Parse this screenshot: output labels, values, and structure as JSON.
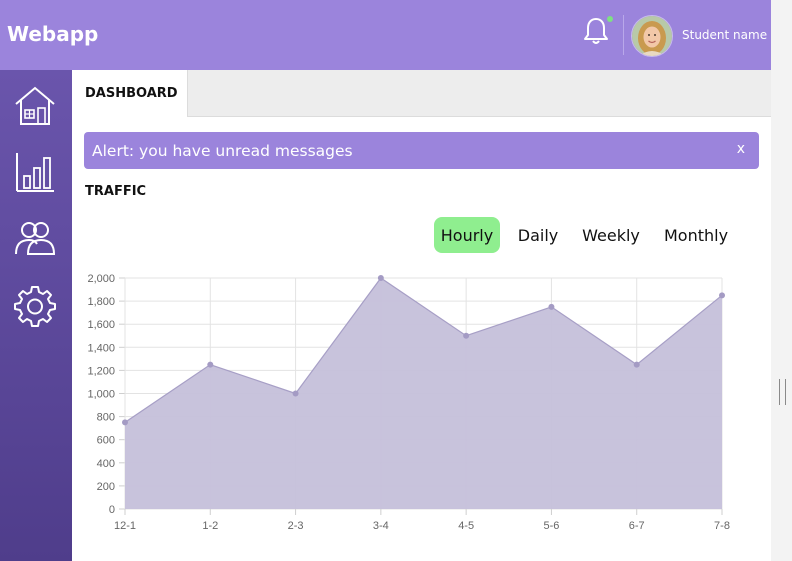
{
  "app": {
    "title": "Webapp"
  },
  "user": {
    "name": "Student name"
  },
  "colors": {
    "accent": "#9b84dc",
    "sidebar": "#5a4799",
    "active_tab_button": "#8fee8f",
    "area_fill": "#c5c0da"
  },
  "sidebar": {
    "items": [
      {
        "icon": "home-icon"
      },
      {
        "icon": "bar-chart-icon"
      },
      {
        "icon": "users-icon"
      },
      {
        "icon": "gear-icon"
      }
    ]
  },
  "tabs": [
    {
      "label": "DASHBOARD",
      "active": true
    }
  ],
  "alert": {
    "text": "Alert: you have unread messages",
    "close_label": "x"
  },
  "traffic": {
    "title": "TRAFFIC",
    "ranges": [
      {
        "label": "Hourly",
        "active": true
      },
      {
        "label": "Daily",
        "active": false
      },
      {
        "label": "Weekly",
        "active": false
      },
      {
        "label": "Monthly",
        "active": false
      }
    ]
  },
  "chart_data": {
    "type": "area",
    "categories": [
      "12-1",
      "1-2",
      "2-3",
      "3-4",
      "4-5",
      "5-6",
      "6-7",
      "7-8"
    ],
    "values": [
      750,
      1250,
      1000,
      2000,
      1500,
      1750,
      1250,
      1850
    ],
    "ylim": [
      0,
      2000
    ],
    "yticks": [
      0,
      200,
      400,
      600,
      800,
      1000,
      1200,
      1400,
      1600,
      1800,
      2000
    ],
    "ytick_labels": [
      "0",
      "200",
      "400",
      "600",
      "800",
      "1,000",
      "1,200",
      "1,400",
      "1,600",
      "1,800",
      "2,000"
    ],
    "grid": true,
    "legend": "none"
  }
}
